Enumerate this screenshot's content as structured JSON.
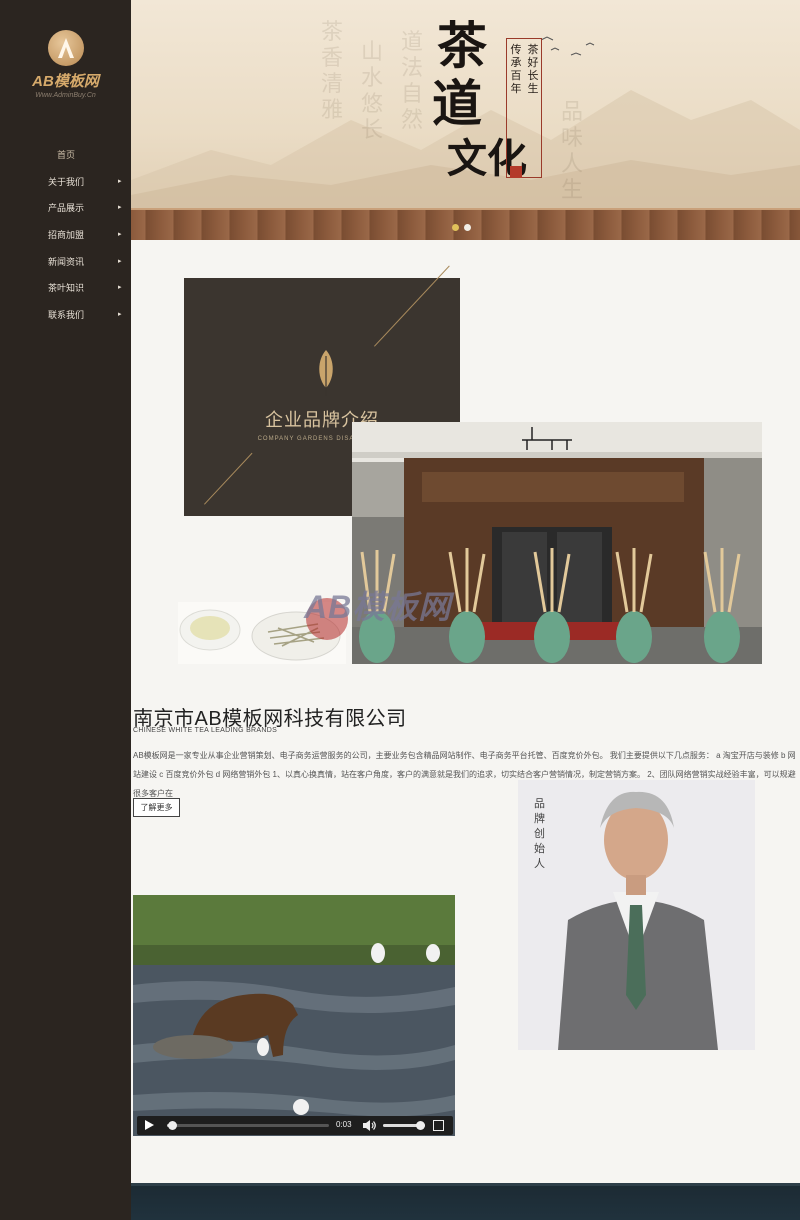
{
  "brand": {
    "logo_letter": "A",
    "name": "AB模板网",
    "subtitle": "Www.AdminBuy.Cn"
  },
  "nav": {
    "home": "首页",
    "items": [
      {
        "label": "关于我们"
      },
      {
        "label": "产品展示"
      },
      {
        "label": "招商加盟"
      },
      {
        "label": "新闻资讯"
      },
      {
        "label": "茶叶知识"
      },
      {
        "label": "联系我们"
      }
    ],
    "arrow": "▸"
  },
  "banner": {
    "title_chars": [
      "茶",
      "道",
      "文化"
    ],
    "poem_col1": "传承百年",
    "poem_col2": "茶好长生",
    "slides_total": 2,
    "slide_active": 1
  },
  "intro": {
    "title": "企业品牌介绍",
    "subtitle": "COMPANY GARDENS DISABILITIES",
    "watermark": "AB模板网"
  },
  "company": {
    "name": "南京市AB模板网科技有限公司",
    "english": "CHINESE WHITE TEA LEADING BRANDS",
    "description": "AB模板网是一家专业从事企业营销策划、电子商务运营服务的公司，主要业务包含精品网站制作、电子商务平台托管、百度竞价外包。 我们主要提供以下几点服务： a 淘宝开店与装修 b 网站建设 c 百度竞价外包 d 网络营销外包 1、以真心换真情，站在客户角度，客户的满意就是我们的追求，切实结合客户营销情况，制定营销方案。 2、团队网络营销实战经验丰富，可以规避很多客户在",
    "more_label": "了解更多"
  },
  "founder": {
    "label": "品牌创始人"
  },
  "video": {
    "time": "0:03",
    "progress": 0.03,
    "volume": 1.0
  },
  "colors": {
    "sidebar": "#2b2520",
    "accent": "#d6aa6b",
    "dot_active": "#e0c15b"
  }
}
